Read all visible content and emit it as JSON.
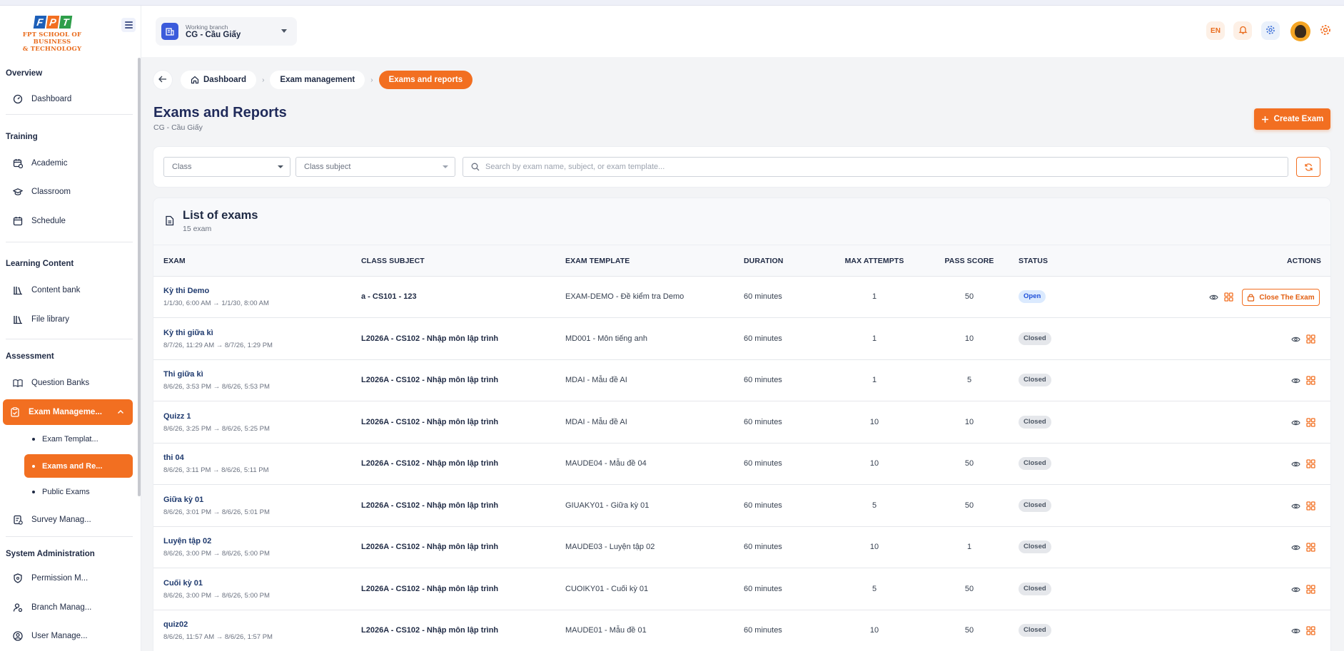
{
  "brand": {
    "logo_letters": [
      "F",
      "P",
      "T"
    ],
    "logo_line1": "FPT SCHOOL OF BUSINESS",
    "logo_line2": "& TECHNOLOGY",
    "accent": "#f26f21",
    "primary": "#1f2a5a"
  },
  "sidebar": {
    "sections": [
      {
        "title": "Overview",
        "items": [
          {
            "label": "Dashboard",
            "icon": "dashboard-gauge-icon"
          }
        ]
      },
      {
        "title": "Training",
        "items": [
          {
            "label": "Academic",
            "icon": "calendar-clock-icon"
          },
          {
            "label": "Classroom",
            "icon": "graduation-cap-icon"
          },
          {
            "label": "Schedule",
            "icon": "calendar-icon"
          }
        ]
      },
      {
        "title": "Learning Content",
        "items": [
          {
            "label": "Content bank",
            "icon": "library-icon"
          },
          {
            "label": "File library",
            "icon": "library-icon"
          }
        ]
      },
      {
        "title": "Assessment",
        "items": [
          {
            "label": "Question Banks",
            "icon": "book-open-icon"
          },
          {
            "label": "Exam Manageme...",
            "icon": "clipboard-check-icon",
            "active": true,
            "children": [
              {
                "label": "Exam Templat..."
              },
              {
                "label": "Exams and Re...",
                "active": true
              },
              {
                "label": "Public Exams"
              }
            ]
          },
          {
            "label": "Survey Manag...",
            "icon": "survey-icon"
          }
        ]
      },
      {
        "title": "System Administration",
        "items": [
          {
            "label": "Permission M...",
            "icon": "shield-icon"
          },
          {
            "label": "Branch Manag...",
            "icon": "user-cog-icon"
          },
          {
            "label": "User Manage...",
            "icon": "user-circle-icon"
          }
        ]
      }
    ]
  },
  "header": {
    "branch_label": "Working branch",
    "branch_value": "CG - Cầu Giấy",
    "language": "EN",
    "icons": [
      "bell-icon",
      "gear-icon",
      "avatar",
      "settings-sun-icon"
    ]
  },
  "breadcrumb": {
    "items": [
      "Dashboard",
      "Exam management",
      "Exams and reports"
    ]
  },
  "page": {
    "title": "Exams and Reports",
    "subtitle": "CG - Cầu Giấy",
    "create_label": "Create Exam"
  },
  "filters": {
    "class_placeholder": "Class",
    "subject_placeholder": "Class subject",
    "search_placeholder": "Search by exam name, subject, or exam template..."
  },
  "list": {
    "title": "List of exams",
    "count": "15 exam",
    "columns": [
      "EXAM",
      "CLASS SUBJECT",
      "EXAM TEMPLATE",
      "DURATION",
      "MAX ATTEMPTS",
      "PASS SCORE",
      "STATUS",
      "ACTIONS"
    ],
    "close_label": "Close The Exam",
    "rows": [
      {
        "name": "Kỳ thi Demo",
        "time": "1/1/30, 6:00 AM → 1/1/30, 8:00 AM",
        "subject": "a - CS101 - 123",
        "template": "EXAM-DEMO - Đề kiểm tra Demo",
        "duration": "60 minutes",
        "attempts": "1",
        "pass": "50",
        "status": "Open"
      },
      {
        "name": "Kỳ thi giữa kì",
        "time": "8/7/26, 11:29 AM → 8/7/26, 1:29 PM",
        "subject": "L2026A - CS102 - Nhập môn lập trình",
        "template": "MD001 - Môn tiếng anh",
        "duration": "60 minutes",
        "attempts": "1",
        "pass": "10",
        "status": "Closed"
      },
      {
        "name": "Thi giữa kì",
        "time": "8/6/26, 3:53 PM → 8/6/26, 5:53 PM",
        "subject": "L2026A - CS102 - Nhập môn lập trình",
        "template": "MDAI - Mẫu đề AI",
        "duration": "60 minutes",
        "attempts": "1",
        "pass": "5",
        "status": "Closed"
      },
      {
        "name": "Quizz 1",
        "time": "8/6/26, 3:25 PM → 8/6/26, 5:25 PM",
        "subject": "L2026A - CS102 - Nhập môn lập trình",
        "template": "MDAI - Mẫu đề AI",
        "duration": "60 minutes",
        "attempts": "10",
        "pass": "10",
        "status": "Closed"
      },
      {
        "name": "thi 04",
        "time": "8/6/26, 3:11 PM → 8/6/26, 5:11 PM",
        "subject": "L2026A - CS102 - Nhập môn lập trình",
        "template": "MAUDE04 - Mẫu đề 04",
        "duration": "60 minutes",
        "attempts": "10",
        "pass": "50",
        "status": "Closed"
      },
      {
        "name": "Giữa kỳ 01",
        "time": "8/6/26, 3:01 PM → 8/6/26, 5:01 PM",
        "subject": "L2026A - CS102 - Nhập môn lập trình",
        "template": "GIUAKY01 - Giữa kỳ 01",
        "duration": "60 minutes",
        "attempts": "5",
        "pass": "50",
        "status": "Closed"
      },
      {
        "name": "Luyện tập 02",
        "time": "8/6/26, 3:00 PM → 8/6/26, 5:00 PM",
        "subject": "L2026A - CS102 - Nhập môn lập trình",
        "template": "MAUDE03 - Luyện tập 02",
        "duration": "60 minutes",
        "attempts": "10",
        "pass": "1",
        "status": "Closed"
      },
      {
        "name": "Cuối kỳ 01",
        "time": "8/6/26, 3:00 PM → 8/6/26, 5:00 PM",
        "subject": "L2026A - CS102 - Nhập môn lập trình",
        "template": "CUOIKY01 - Cuối kỳ 01",
        "duration": "60 minutes",
        "attempts": "5",
        "pass": "50",
        "status": "Closed"
      },
      {
        "name": "quiz02",
        "time": "8/6/26, 11:57 AM → 8/6/26, 1:57 PM",
        "subject": "L2026A - CS102 - Nhập môn lập trình",
        "template": "MAUDE01 - Mẫu đề 01",
        "duration": "60 minutes",
        "attempts": "10",
        "pass": "50",
        "status": "Closed"
      }
    ]
  }
}
